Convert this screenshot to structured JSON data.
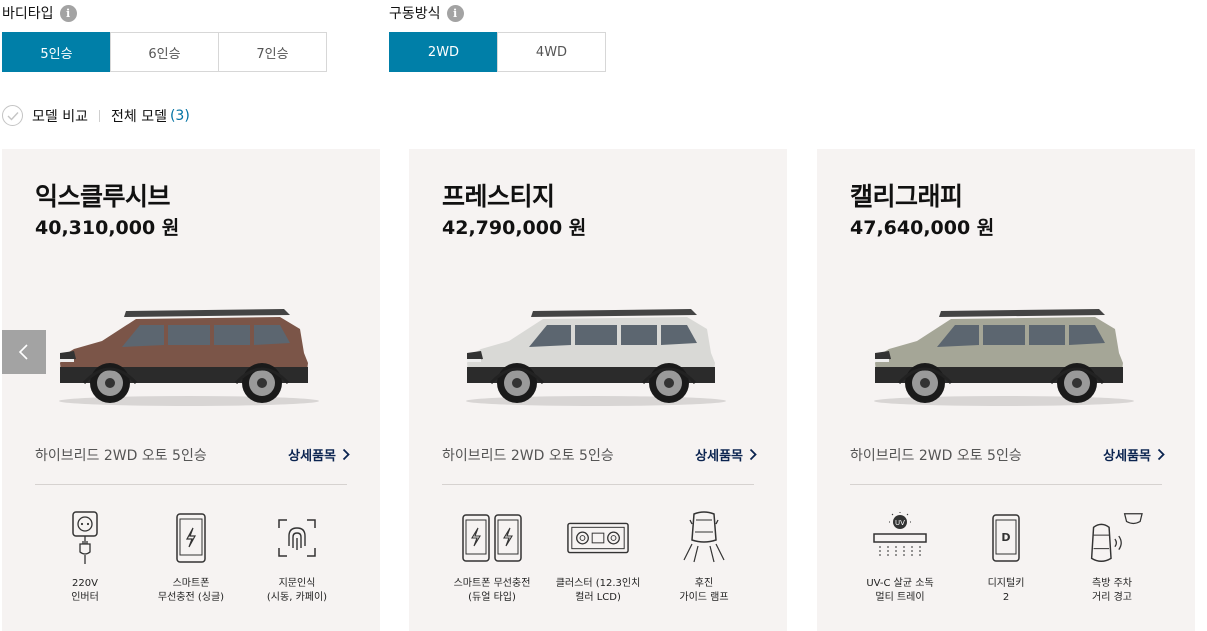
{
  "filters": {
    "body_type": {
      "title": "바디타입",
      "options": [
        "5인승",
        "6인승",
        "7인승"
      ],
      "selected": "5인승"
    },
    "drive": {
      "title": "구동방식",
      "options": [
        "2WD",
        "4WD"
      ],
      "selected": "2WD"
    }
  },
  "compare": {
    "label": "모델 비교",
    "all_models_label": "전체 모델",
    "count": "(3)"
  },
  "cards": [
    {
      "name": "익스클루시브",
      "price": "40,310,000 원",
      "car_color": "#7b5548",
      "spec": "하이브리드 2WD 오토 5인승",
      "detail_label": "상세품목",
      "features": [
        {
          "label": "220V\n인버터",
          "icon": "power-outlet-icon"
        },
        {
          "label": "스마트폰\n무선충전 (싱글)",
          "icon": "wireless-charge-icon"
        },
        {
          "label": "지문인식\n(시동, 카페이)",
          "icon": "fingerprint-icon"
        }
      ]
    },
    {
      "name": "프레스티지",
      "price": "42,790,000 원",
      "car_color": "#d9d9d6",
      "spec": "하이브리드 2WD 오토 5인승",
      "detail_label": "상세품목",
      "features": [
        {
          "label": "스마트폰 무선충전\n(듀얼 타입)",
          "icon": "dual-wireless-charge-icon"
        },
        {
          "label": "클러스터 (12.3인치\n컬러 LCD)",
          "icon": "cluster-icon"
        },
        {
          "label": "후진\n가이드 램프",
          "icon": "reverse-guide-lamp-icon"
        }
      ]
    },
    {
      "name": "캘리그래피",
      "price": "47,640,000 원",
      "car_color": "#a5a697",
      "spec": "하이브리드 2WD 오토 5인승",
      "detail_label": "상세품목",
      "features": [
        {
          "label": "UV-C 살균 소독\n멀티 트레이",
          "icon": "uv-tray-icon"
        },
        {
          "label": "디지털키\n2",
          "icon": "digital-key-icon"
        },
        {
          "label": "측방 주차\n거리 경고",
          "icon": "side-parking-warning-icon"
        }
      ]
    }
  ]
}
